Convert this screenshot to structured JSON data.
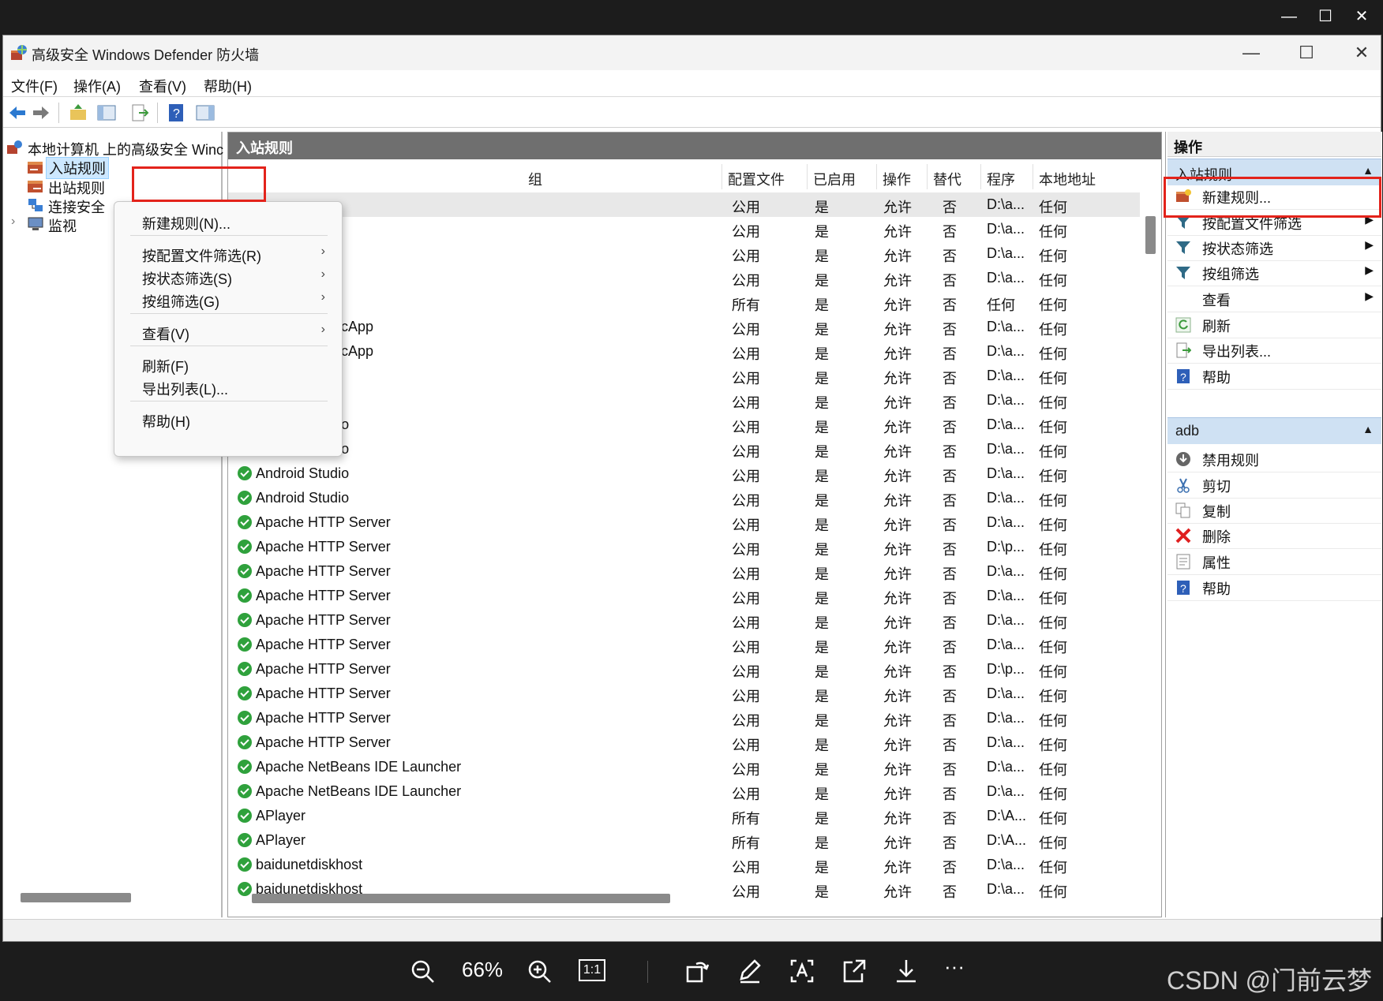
{
  "window": {
    "title": "高级安全 Windows Defender 防火墙",
    "controls": {
      "minimize": "—",
      "maximize": "☐",
      "close": "✕"
    }
  },
  "menubar": [
    "文件(F)",
    "操作(A)",
    "查看(V)",
    "帮助(H)"
  ],
  "toolbar_icons": [
    "back-icon",
    "forward-icon",
    "up-folder-icon",
    "show-hide-tree-icon",
    "export-icon",
    "help-icon",
    "show-hide-action-icon"
  ],
  "tree": {
    "root": "本地计算机 上的高级安全 Winc",
    "items": [
      {
        "label": "入站规则",
        "icon": "inbound-rules-icon",
        "selected": true
      },
      {
        "label": "出站规则",
        "icon": "outbound-rules-icon"
      },
      {
        "label": "连接安全",
        "icon": "connection-security-icon"
      },
      {
        "label": "监视",
        "icon": "monitor-icon",
        "expander": "›"
      }
    ]
  },
  "center": {
    "header": "入站规则",
    "columns": [
      "组",
      "配置文件",
      "已启用",
      "操作",
      "替代",
      "程序",
      "本地地址"
    ],
    "rows": [
      {
        "name": "",
        "profile": "公用",
        "enabled": "是",
        "action": "允许",
        "override": "否",
        "program": "D:\\a...",
        "local": "任何",
        "check": false
      },
      {
        "name": "",
        "profile": "公用",
        "enabled": "是",
        "action": "允许",
        "override": "否",
        "program": "D:\\a...",
        "local": "任何",
        "check": false
      },
      {
        "name": "",
        "profile": "公用",
        "enabled": "是",
        "action": "允许",
        "override": "否",
        "program": "D:\\a...",
        "local": "任何",
        "check": false
      },
      {
        "name": "",
        "profile": "公用",
        "enabled": "是",
        "action": "允许",
        "override": "否",
        "program": "D:\\a...",
        "local": "任何",
        "check": false
      },
      {
        "name": "",
        "profile": "所有",
        "enabled": "是",
        "action": "允许",
        "override": "否",
        "program": "任何",
        "local": "任何",
        "check": false
      },
      {
        "name": "ıncApp",
        "profile": "公用",
        "enabled": "是",
        "action": "允许",
        "override": "否",
        "program": "D:\\a...",
        "local": "任何",
        "check": false
      },
      {
        "name": "ıncApp",
        "profile": "公用",
        "enabled": "是",
        "action": "允许",
        "override": "否",
        "program": "D:\\a...",
        "local": "任何",
        "check": false
      },
      {
        "name": "o",
        "profile": "公用",
        "enabled": "是",
        "action": "允许",
        "override": "否",
        "program": "D:\\a...",
        "local": "任何",
        "check": false
      },
      {
        "name": "o",
        "profile": "公用",
        "enabled": "是",
        "action": "允许",
        "override": "否",
        "program": "D:\\a...",
        "local": "任何",
        "check": false
      },
      {
        "name": "Android Studio",
        "profile": "公用",
        "enabled": "是",
        "action": "允许",
        "override": "否",
        "program": "D:\\a...",
        "local": "任何",
        "check": true
      },
      {
        "name": "Android Studio",
        "profile": "公用",
        "enabled": "是",
        "action": "允许",
        "override": "否",
        "program": "D:\\a...",
        "local": "任何",
        "check": true
      },
      {
        "name": "Android Studio",
        "profile": "公用",
        "enabled": "是",
        "action": "允许",
        "override": "否",
        "program": "D:\\a...",
        "local": "任何",
        "check": true
      },
      {
        "name": "Android Studio",
        "profile": "公用",
        "enabled": "是",
        "action": "允许",
        "override": "否",
        "program": "D:\\a...",
        "local": "任何",
        "check": true
      },
      {
        "name": "Apache HTTP Server",
        "profile": "公用",
        "enabled": "是",
        "action": "允许",
        "override": "否",
        "program": "D:\\a...",
        "local": "任何",
        "check": true
      },
      {
        "name": "Apache HTTP Server",
        "profile": "公用",
        "enabled": "是",
        "action": "允许",
        "override": "否",
        "program": "D:\\p...",
        "local": "任何",
        "check": true
      },
      {
        "name": "Apache HTTP Server",
        "profile": "公用",
        "enabled": "是",
        "action": "允许",
        "override": "否",
        "program": "D:\\a...",
        "local": "任何",
        "check": true
      },
      {
        "name": "Apache HTTP Server",
        "profile": "公用",
        "enabled": "是",
        "action": "允许",
        "override": "否",
        "program": "D:\\a...",
        "local": "任何",
        "check": true
      },
      {
        "name": "Apache HTTP Server",
        "profile": "公用",
        "enabled": "是",
        "action": "允许",
        "override": "否",
        "program": "D:\\a...",
        "local": "任何",
        "check": true
      },
      {
        "name": "Apache HTTP Server",
        "profile": "公用",
        "enabled": "是",
        "action": "允许",
        "override": "否",
        "program": "D:\\a...",
        "local": "任何",
        "check": true
      },
      {
        "name": "Apache HTTP Server",
        "profile": "公用",
        "enabled": "是",
        "action": "允许",
        "override": "否",
        "program": "D:\\p...",
        "local": "任何",
        "check": true
      },
      {
        "name": "Apache HTTP Server",
        "profile": "公用",
        "enabled": "是",
        "action": "允许",
        "override": "否",
        "program": "D:\\a...",
        "local": "任何",
        "check": true
      },
      {
        "name": "Apache HTTP Server",
        "profile": "公用",
        "enabled": "是",
        "action": "允许",
        "override": "否",
        "program": "D:\\a...",
        "local": "任何",
        "check": true
      },
      {
        "name": "Apache HTTP Server",
        "profile": "公用",
        "enabled": "是",
        "action": "允许",
        "override": "否",
        "program": "D:\\a...",
        "local": "任何",
        "check": true
      },
      {
        "name": "Apache NetBeans IDE Launcher",
        "profile": "公用",
        "enabled": "是",
        "action": "允许",
        "override": "否",
        "program": "D:\\a...",
        "local": "任何",
        "check": true
      },
      {
        "name": "Apache NetBeans IDE Launcher",
        "profile": "公用",
        "enabled": "是",
        "action": "允许",
        "override": "否",
        "program": "D:\\a...",
        "local": "任何",
        "check": true
      },
      {
        "name": "APlayer",
        "profile": "所有",
        "enabled": "是",
        "action": "允许",
        "override": "否",
        "program": "D:\\A...",
        "local": "任何",
        "check": true
      },
      {
        "name": "APlayer",
        "profile": "所有",
        "enabled": "是",
        "action": "允许",
        "override": "否",
        "program": "D:\\A...",
        "local": "任何",
        "check": true
      },
      {
        "name": "baidunetdiskhost",
        "profile": "公用",
        "enabled": "是",
        "action": "允许",
        "override": "否",
        "program": "D:\\a...",
        "local": "任何",
        "check": true
      },
      {
        "name": "baidunetdiskhost",
        "profile": "公用",
        "enabled": "是",
        "action": "允许",
        "override": "否",
        "program": "D:\\a...",
        "local": "任何",
        "check": true
      }
    ]
  },
  "actions": {
    "header": "操作",
    "sections": [
      {
        "title": "入站规则",
        "items": [
          {
            "label": "新建规则...",
            "icon": "new-rule-icon"
          },
          {
            "label": "按配置文件筛选",
            "icon": "filter-icon",
            "submenu": true
          },
          {
            "label": "按状态筛选",
            "icon": "filter-icon",
            "submenu": true
          },
          {
            "label": "按组筛选",
            "icon": "filter-icon",
            "submenu": true
          },
          {
            "label": "查看",
            "icon": "",
            "submenu": true
          },
          {
            "label": "刷新",
            "icon": "refresh-icon"
          },
          {
            "label": "导出列表...",
            "icon": "export-icon"
          },
          {
            "label": "帮助",
            "icon": "help-icon"
          }
        ]
      },
      {
        "title": "adb",
        "items": [
          {
            "label": "禁用规则",
            "icon": "disable-icon"
          },
          {
            "label": "剪切",
            "icon": "cut-icon"
          },
          {
            "label": "复制",
            "icon": "copy-icon"
          },
          {
            "label": "删除",
            "icon": "delete-icon"
          },
          {
            "label": "属性",
            "icon": "properties-icon"
          },
          {
            "label": "帮助",
            "icon": "help-icon"
          }
        ]
      }
    ]
  },
  "context_menu": {
    "items": [
      {
        "label": "新建规则(N)..."
      },
      {
        "label": "按配置文件筛选(R)",
        "submenu": true
      },
      {
        "label": "按状态筛选(S)",
        "submenu": true
      },
      {
        "label": "按组筛选(G)",
        "submenu": true
      },
      {
        "label": "查看(V)",
        "submenu": true
      },
      {
        "label": "刷新(F)"
      },
      {
        "label": "导出列表(L)..."
      },
      {
        "label": "帮助(H)"
      }
    ]
  },
  "viewer": {
    "zoom": "66%",
    "one_to_one": "1:1",
    "more": "···",
    "watermark": "CSDN @门前云梦"
  },
  "colors": {
    "highlight": "#e3231b",
    "header_gray": "#6f6f6f",
    "section_blue": "#cfe1f3",
    "check_green": "#2fa13c"
  }
}
